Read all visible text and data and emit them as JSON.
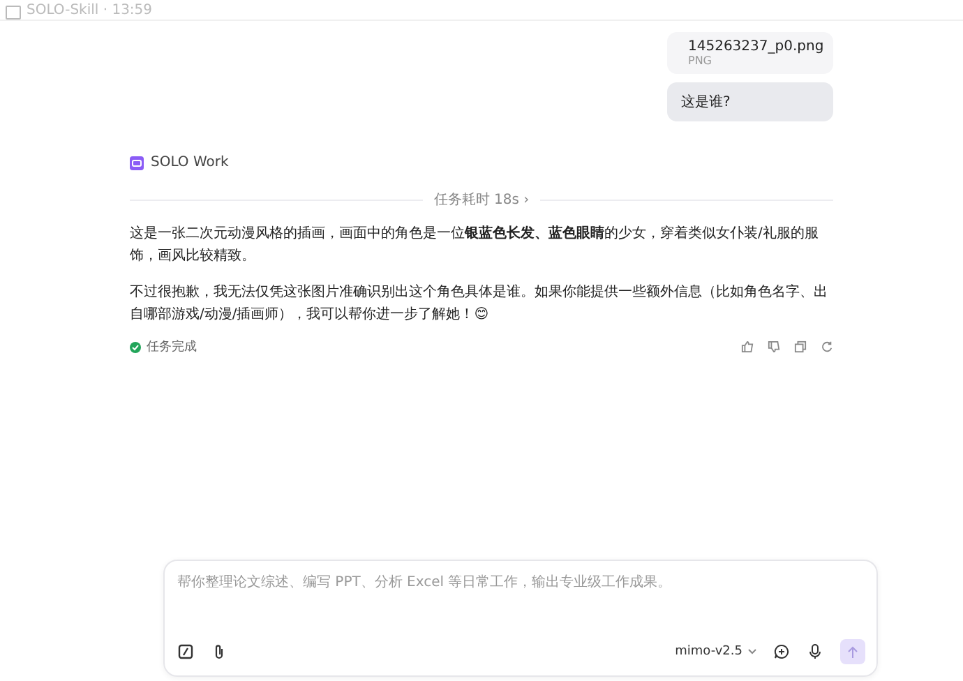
{
  "header": {
    "title": "SOLO-Skill · 13:59"
  },
  "user_messages": [
    {
      "kind": "file",
      "name": "145263237_p0.png",
      "type": "PNG"
    },
    {
      "kind": "text",
      "text": "这是谁?"
    }
  ],
  "assistant": {
    "name": "SOLO Work",
    "duration": "任务耗时 18s ›",
    "paragraphs": [
      "这是一张二次元动漫风格的插画，画面中的角色是一位**银蓝色长发、蓝色眼睛**的少女，穿着类似女仆装/礼服的服饰，画风比较精致。",
      "不过很抱歉，我无法仅凭这张图片准确识别出这个角色具体是谁。如果你能提供一些额外信息（比如角色名字、出自哪部游戏/动漫/插画师），我可以帮你进一步了解她！😊"
    ],
    "status": "任务完成"
  },
  "composer": {
    "placeholder": "帮你整理论文综述、编写 PPT、分析 Excel 等日常工作，输出专业级工作成果。",
    "model": "mimo-v2.5"
  }
}
